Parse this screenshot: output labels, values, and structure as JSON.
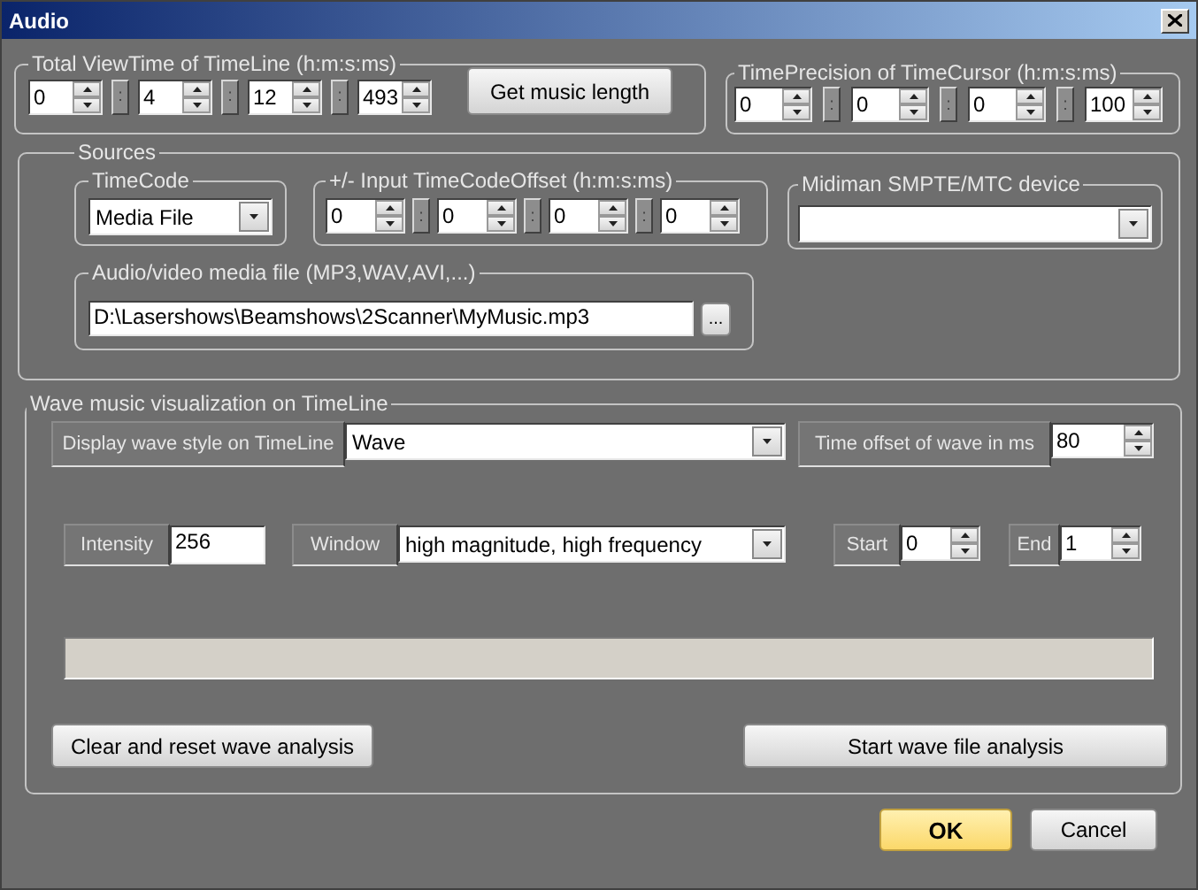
{
  "window": {
    "title": "Audio"
  },
  "total_view_time": {
    "title": "Total ViewTime of TimeLine (h:m:s:ms)",
    "fields": [
      "0",
      "4",
      "12",
      "493"
    ],
    "separators": [
      ":",
      ":",
      ":"
    ],
    "button": "Get music length"
  },
  "time_precision": {
    "title": "TimePrecision of TimeCursor (h:m:s:ms)",
    "fields": [
      "0",
      "0",
      "0",
      "100"
    ],
    "separators": [
      ":",
      ":",
      ":"
    ]
  },
  "sources": {
    "title": "Sources",
    "timecode": {
      "title": "TimeCode",
      "value": "Media File"
    },
    "offset": {
      "title": "+/- Input TimeCodeOffset (h:m:s:ms)",
      "fields": [
        "0",
        "0",
        "0",
        "0"
      ],
      "separators": [
        ":",
        ":",
        ":"
      ]
    },
    "midiman": {
      "title": "Midiman SMPTE/MTC device"
    },
    "media_file": {
      "title": "Audio/video media file (MP3,WAV,AVI,...)",
      "value": "D:\\Lasershows\\Beamshows\\2Scanner\\MyMusic.mp3",
      "browse": "..."
    }
  },
  "wave": {
    "title": "Wave music visualization on TimeLine",
    "display_style": {
      "label": "Display wave style on TimeLine",
      "value": "Wave"
    },
    "time_offset": {
      "label": "Time offset of wave in ms",
      "value": "80"
    },
    "intensity": {
      "label": "Intensity",
      "value": "256"
    },
    "window": {
      "label": "Window",
      "value": "high magnitude, high frequency"
    },
    "start": {
      "label": "Start",
      "value": "0"
    },
    "end": {
      "label": "End",
      "value": "1"
    },
    "analysis_bar": {
      "level": 0
    },
    "buttons": [
      "Clear and reset wave analysis",
      "Start wave file analysis"
    ]
  },
  "dialog_buttons": [
    {
      "label": "OK",
      "default": true
    },
    {
      "label": "Cancel",
      "default": false
    }
  ]
}
